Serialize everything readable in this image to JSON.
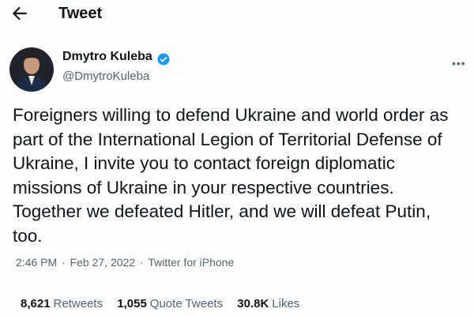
{
  "header": {
    "title": "Tweet",
    "back_icon": "arrow-left-icon"
  },
  "author": {
    "name": "Dmytro Kuleba",
    "handle": "@DmytroKuleba",
    "verified_icon": "verified-badge-icon"
  },
  "tweet": {
    "lines": [
      "Foreigners willing to defend Ukraine and world order as",
      "part of the International Legion of Territorial Defense of",
      "Ukraine, I invite you to contact foreign diplomatic",
      "missions of Ukraine in your respective countries.",
      "Together we defeated Hitler, and we will defeat Putin,",
      "too."
    ]
  },
  "meta": {
    "time": "2:46 PM",
    "sep1": "·",
    "date": "Feb 27, 2022",
    "sep2": "·",
    "source": "Twitter for iPhone"
  },
  "stats": {
    "retweets_count": "8,621",
    "retweets_label": "Retweets",
    "quotes_count": "1,055",
    "quotes_label": "Quote Tweets",
    "likes_count": "30.8K",
    "likes_label": "Likes"
  },
  "colors": {
    "text": "#0f1419",
    "secondary": "#536471",
    "accent": "#1d9bf0"
  }
}
